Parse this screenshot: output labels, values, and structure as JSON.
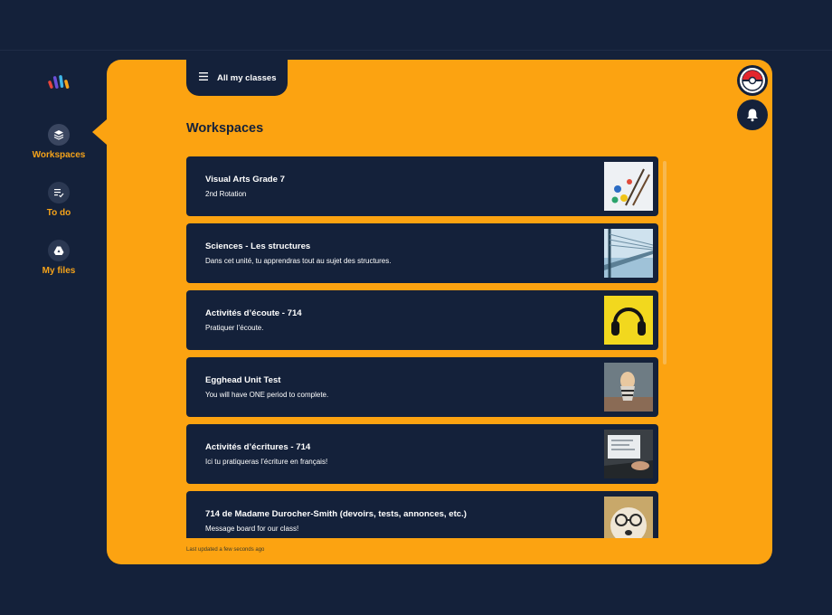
{
  "sidebar": {
    "items": [
      {
        "label": "Workspaces",
        "icon": "layers-icon"
      },
      {
        "label": "To do",
        "icon": "checklist-icon"
      },
      {
        "label": "My files",
        "icon": "drive-icon"
      }
    ]
  },
  "header": {
    "classes_button": "All my classes"
  },
  "main": {
    "title": "Workspaces",
    "cards": [
      {
        "title": "Visual Arts Grade 7",
        "desc": "2nd Rotation",
        "image": "paint-palette"
      },
      {
        "title": "Sciences - Les structures",
        "desc": "Dans cet unité, tu apprendras tout au sujet des structures.",
        "image": "bridge"
      },
      {
        "title": "Activités d’écoute - 714",
        "desc": "Pratiquer l’écoute.",
        "image": "headphones"
      },
      {
        "title": "Egghead Unit Test",
        "desc": "You will have ONE period to complete.",
        "image": "egg-cup"
      },
      {
        "title": "Activités d’écritures - 714",
        "desc": "Ici tu pratiqueras l’écriture en français!",
        "image": "laptop"
      },
      {
        "title": "714 de Madame Durocher-Smith (devoirs, tests, annonces, etc.)",
        "desc": "Message board for our class!",
        "image": "dog-glasses"
      }
    ],
    "footer": "Last updated a few seconds ago"
  },
  "colors": {
    "background": "#14213a",
    "panel": "#fca311",
    "accent": "#f5a31a"
  }
}
